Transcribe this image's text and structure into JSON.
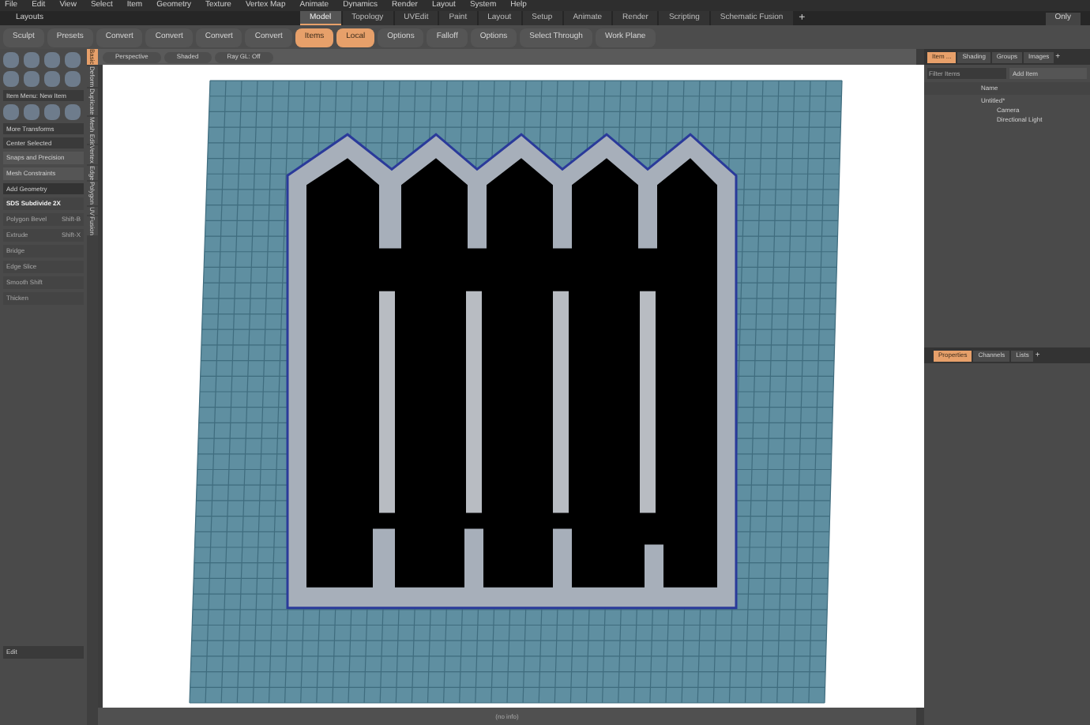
{
  "menu_bar": [
    "File",
    "Edit",
    "View",
    "Select",
    "Item",
    "Geometry",
    "Texture",
    "Vertex Map",
    "Animate",
    "Dynamics",
    "Render",
    "Layout",
    "System",
    "Help"
  ],
  "layouts_label": "Layouts",
  "layout_tabs": [
    {
      "label": "Model",
      "selected": true
    },
    {
      "label": "Topology",
      "selected": false
    },
    {
      "label": "UVEdit",
      "selected": false
    },
    {
      "label": "Paint",
      "selected": false
    },
    {
      "label": "Layout",
      "selected": false
    },
    {
      "label": "Setup",
      "selected": false
    },
    {
      "label": "Animate",
      "selected": false
    },
    {
      "label": "Render",
      "selected": false
    },
    {
      "label": "Scripting",
      "selected": false
    },
    {
      "label": "Schematic Fusion",
      "selected": false
    }
  ],
  "add_tab": "+",
  "only_button": "Only",
  "toolbar": [
    {
      "label": "Sculpt",
      "selected": false
    },
    {
      "label": "Presets",
      "selected": false
    },
    {
      "label": "Convert",
      "selected": false
    },
    {
      "label": "Convert",
      "selected": false
    },
    {
      "label": "Convert",
      "selected": false
    },
    {
      "label": "Convert",
      "selected": false
    },
    {
      "label": "Items",
      "selected": true
    },
    {
      "label": "Local",
      "selected": true
    },
    {
      "label": "Options",
      "selected": false
    },
    {
      "label": "Falloff",
      "selected": false
    },
    {
      "label": "Options",
      "selected": false
    },
    {
      "label": "Select Through",
      "selected": false
    },
    {
      "label": "Work Plane",
      "selected": false
    }
  ],
  "viewport_header": [
    "Perspective",
    "Shaded",
    "Ray GL: Off"
  ],
  "toolbox": {
    "item_menu": "Item Menu: New Item",
    "dropdowns": [
      "More Transforms",
      "Center Selected"
    ],
    "buttons": [
      "Snaps and Precision",
      "Mesh Constraints"
    ],
    "section": "Add Geometry",
    "tools": [
      {
        "label": "SDS Subdivide 2X",
        "disabled": false
      },
      {
        "label": "Polygon Bevel",
        "shortcut": "Shift-B",
        "disabled": true
      },
      {
        "label": "Extrude",
        "shortcut": "Shift-X",
        "disabled": true
      },
      {
        "label": "Bridge",
        "disabled": true
      },
      {
        "label": "Edge Slice",
        "disabled": true
      },
      {
        "label": "Smooth Shift",
        "disabled": true
      },
      {
        "label": "Thicken",
        "disabled": true
      }
    ],
    "bottom_dropdown": "Edit"
  },
  "side_tabs": [
    {
      "label": "Basic",
      "selected": true
    },
    {
      "label": "Deform",
      "selected": false
    },
    {
      "label": "Duplicate",
      "selected": false
    },
    {
      "label": "Mesh Edit",
      "selected": false
    },
    {
      "label": "Vertex",
      "selected": false
    },
    {
      "label": "Edge",
      "selected": false
    },
    {
      "label": "Polygon",
      "selected": false
    },
    {
      "label": "UV",
      "selected": false
    },
    {
      "label": "Fusion",
      "selected": false
    }
  ],
  "item_panel": {
    "tabs": [
      {
        "label": "Item ...",
        "selected": true
      },
      {
        "label": "Shading",
        "selected": false
      },
      {
        "label": "Groups",
        "selected": false
      },
      {
        "label": "Images",
        "selected": false
      }
    ],
    "add_tab": "+",
    "filter_placeholder": "Filter Items",
    "add_item": "Add Item",
    "name_column": "Name",
    "tree": [
      {
        "label": "Untitled*",
        "children": [
          {
            "label": "Camera"
          },
          {
            "label": "Directional Light"
          }
        ]
      }
    ]
  },
  "properties_panel": {
    "tabs": [
      {
        "label": "Properties",
        "selected": true
      },
      {
        "label": "Channels",
        "selected": false
      },
      {
        "label": "Lists",
        "selected": false
      }
    ],
    "add_tab": "+"
  },
  "status_bar": "(no info)"
}
